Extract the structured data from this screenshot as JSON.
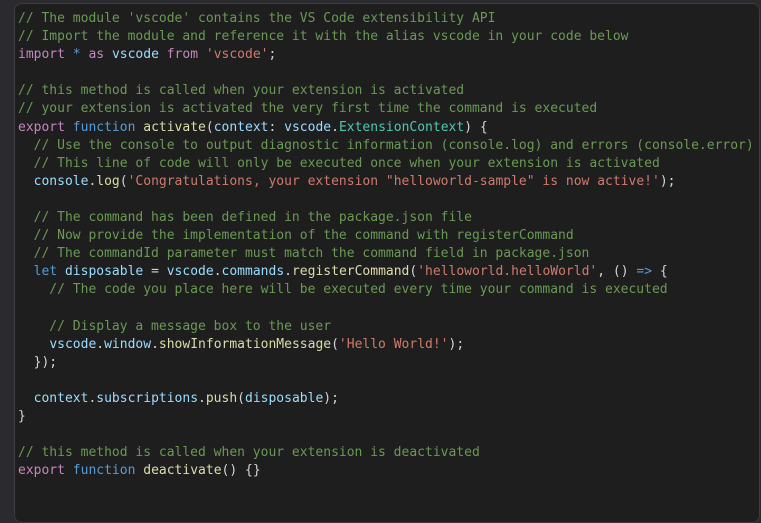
{
  "editor": {
    "language": "typescript",
    "background": "#1e1e1e",
    "outer_background": "#2b2b2f",
    "border_color": "#3c3c41",
    "font_size_px": 13,
    "line_height_px": 18
  },
  "palette": {
    "comment": "#6A9955",
    "keyword": "#C586C0",
    "control": "#569CD6",
    "function": "#DCDCAA",
    "variable": "#9CDCFE",
    "type": "#4EC9B0",
    "string": "#CE7B6D",
    "punctuation": "#D4D4D4",
    "foreground": "#D4D4D4"
  },
  "code": {
    "lines": [
      {
        "n": 1,
        "tokens": [
          {
            "c": "comment",
            "t": "// The module 'vscode' contains the VS Code extensibility API"
          }
        ]
      },
      {
        "n": 2,
        "tokens": [
          {
            "c": "comment",
            "t": "// Import the module and reference it with the alias vscode in your code below"
          }
        ]
      },
      {
        "n": 3,
        "tokens": [
          {
            "c": "keyword",
            "t": "import"
          },
          {
            "c": "plain",
            "t": " "
          },
          {
            "c": "control",
            "t": "*"
          },
          {
            "c": "plain",
            "t": " "
          },
          {
            "c": "keyword",
            "t": "as"
          },
          {
            "c": "plain",
            "t": " "
          },
          {
            "c": "var",
            "t": "vscode"
          },
          {
            "c": "plain",
            "t": " "
          },
          {
            "c": "keyword",
            "t": "from"
          },
          {
            "c": "plain",
            "t": " "
          },
          {
            "c": "string",
            "t": "'vscode'"
          },
          {
            "c": "punct",
            "t": ";"
          }
        ]
      },
      {
        "n": 4,
        "tokens": []
      },
      {
        "n": 5,
        "tokens": [
          {
            "c": "comment",
            "t": "// this method is called when your extension is activated"
          }
        ]
      },
      {
        "n": 6,
        "tokens": [
          {
            "c": "comment",
            "t": "// your extension is activated the very first time the command is executed"
          }
        ]
      },
      {
        "n": 7,
        "tokens": [
          {
            "c": "keyword",
            "t": "export"
          },
          {
            "c": "plain",
            "t": " "
          },
          {
            "c": "control",
            "t": "function"
          },
          {
            "c": "plain",
            "t": " "
          },
          {
            "c": "func",
            "t": "activate"
          },
          {
            "c": "punct",
            "t": "("
          },
          {
            "c": "var",
            "t": "context"
          },
          {
            "c": "punct",
            "t": ": "
          },
          {
            "c": "var",
            "t": "vscode"
          },
          {
            "c": "punct",
            "t": "."
          },
          {
            "c": "type",
            "t": "ExtensionContext"
          },
          {
            "c": "punct",
            "t": ") {"
          }
        ]
      },
      {
        "n": 8,
        "tokens": [
          {
            "c": "comment",
            "t": "  // Use the console to output diagnostic information (console.log) and errors (console.error)"
          }
        ]
      },
      {
        "n": 9,
        "tokens": [
          {
            "c": "comment",
            "t": "  // This line of code will only be executed once when your extension is activated"
          }
        ]
      },
      {
        "n": 10,
        "tokens": [
          {
            "c": "plain",
            "t": "  "
          },
          {
            "c": "var",
            "t": "console"
          },
          {
            "c": "punct",
            "t": "."
          },
          {
            "c": "func",
            "t": "log"
          },
          {
            "c": "punct",
            "t": "("
          },
          {
            "c": "string",
            "t": "'Congratulations, your extension \"helloworld-sample\" is now active!'"
          },
          {
            "c": "punct",
            "t": ");"
          }
        ]
      },
      {
        "n": 11,
        "tokens": []
      },
      {
        "n": 12,
        "tokens": [
          {
            "c": "comment",
            "t": "  // The command has been defined in the package.json file"
          }
        ]
      },
      {
        "n": 13,
        "tokens": [
          {
            "c": "comment",
            "t": "  // Now provide the implementation of the command with registerCommand"
          }
        ]
      },
      {
        "n": 14,
        "tokens": [
          {
            "c": "comment",
            "t": "  // The commandId parameter must match the command field in package.json"
          }
        ]
      },
      {
        "n": 15,
        "tokens": [
          {
            "c": "plain",
            "t": "  "
          },
          {
            "c": "control",
            "t": "let"
          },
          {
            "c": "plain",
            "t": " "
          },
          {
            "c": "var",
            "t": "disposable"
          },
          {
            "c": "punct",
            "t": " = "
          },
          {
            "c": "var",
            "t": "vscode"
          },
          {
            "c": "punct",
            "t": "."
          },
          {
            "c": "var",
            "t": "commands"
          },
          {
            "c": "punct",
            "t": "."
          },
          {
            "c": "func",
            "t": "registerCommand"
          },
          {
            "c": "punct",
            "t": "("
          },
          {
            "c": "string",
            "t": "'helloworld.helloWorld'"
          },
          {
            "c": "punct",
            "t": ", () "
          },
          {
            "c": "control",
            "t": "=>"
          },
          {
            "c": "punct",
            "t": " {"
          }
        ]
      },
      {
        "n": 16,
        "tokens": [
          {
            "c": "comment",
            "t": "    // The code you place here will be executed every time your command is executed"
          }
        ]
      },
      {
        "n": 17,
        "tokens": []
      },
      {
        "n": 18,
        "tokens": [
          {
            "c": "comment",
            "t": "    // Display a message box to the user"
          }
        ]
      },
      {
        "n": 19,
        "tokens": [
          {
            "c": "plain",
            "t": "    "
          },
          {
            "c": "var",
            "t": "vscode"
          },
          {
            "c": "punct",
            "t": "."
          },
          {
            "c": "var",
            "t": "window"
          },
          {
            "c": "punct",
            "t": "."
          },
          {
            "c": "func",
            "t": "showInformationMessage"
          },
          {
            "c": "punct",
            "t": "("
          },
          {
            "c": "string",
            "t": "'Hello World!'"
          },
          {
            "c": "punct",
            "t": ");"
          }
        ]
      },
      {
        "n": 20,
        "tokens": [
          {
            "c": "punct",
            "t": "  });"
          }
        ]
      },
      {
        "n": 21,
        "tokens": []
      },
      {
        "n": 22,
        "tokens": [
          {
            "c": "plain",
            "t": "  "
          },
          {
            "c": "var",
            "t": "context"
          },
          {
            "c": "punct",
            "t": "."
          },
          {
            "c": "var",
            "t": "subscriptions"
          },
          {
            "c": "punct",
            "t": "."
          },
          {
            "c": "func",
            "t": "push"
          },
          {
            "c": "punct",
            "t": "("
          },
          {
            "c": "var",
            "t": "disposable"
          },
          {
            "c": "punct",
            "t": ");"
          }
        ]
      },
      {
        "n": 23,
        "tokens": [
          {
            "c": "punct",
            "t": "}"
          }
        ]
      },
      {
        "n": 24,
        "tokens": []
      },
      {
        "n": 25,
        "tokens": [
          {
            "c": "comment",
            "t": "// this method is called when your extension is deactivated"
          }
        ]
      },
      {
        "n": 26,
        "tokens": [
          {
            "c": "keyword",
            "t": "export"
          },
          {
            "c": "plain",
            "t": " "
          },
          {
            "c": "control",
            "t": "function"
          },
          {
            "c": "plain",
            "t": " "
          },
          {
            "c": "func",
            "t": "deactivate"
          },
          {
            "c": "punct",
            "t": "() {}"
          }
        ]
      }
    ]
  }
}
